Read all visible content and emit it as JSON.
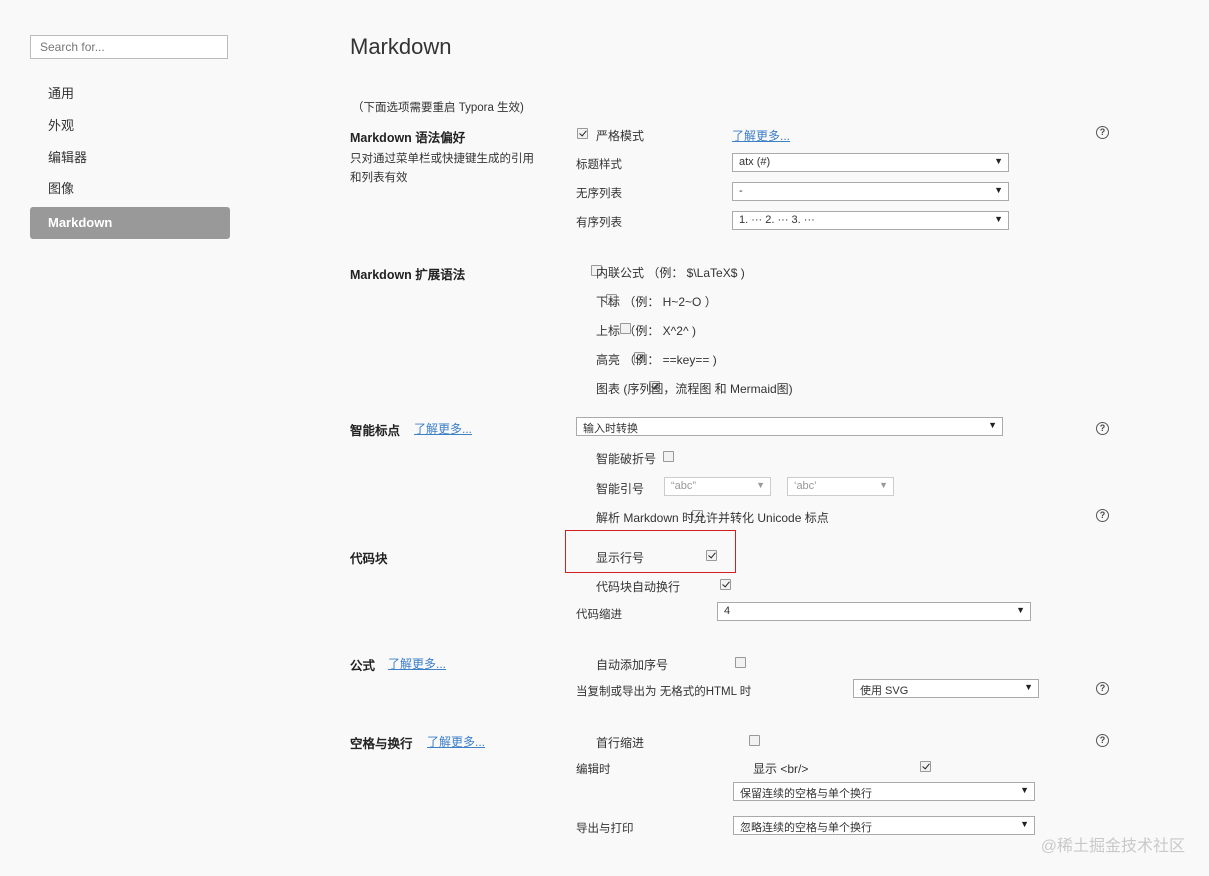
{
  "sidebar": {
    "search_placeholder": "Search for...",
    "items": [
      {
        "label": "通用"
      },
      {
        "label": "外观"
      },
      {
        "label": "编辑器"
      },
      {
        "label": "图像"
      },
      {
        "label": "Markdown",
        "active": true
      }
    ]
  },
  "page": {
    "title": "Markdown",
    "restart_note": "（下面选项需要重启 Typora 生效)"
  },
  "syntax_pref": {
    "label": "Markdown 语法偏好",
    "desc_line1": "只对通过菜单栏或快捷键生成的引用",
    "desc_line2": "和列表有效",
    "strict_label": "严格模式",
    "strict_checked": true,
    "learn_more": "了解更多...",
    "heading_style_label": "标题样式",
    "heading_style_value": "atx (#)",
    "ul_label": "无序列表",
    "ul_value": "-",
    "ol_label": "有序列表",
    "ol_value": "1. ··· 2. ··· 3. ···"
  },
  "ext_syntax": {
    "label": "Markdown 扩展语法",
    "options": [
      {
        "label": "内联公式 （例：  $\\LaTeX$ )",
        "checked": false
      },
      {
        "label": "下标 （例：  H~2~O ）",
        "checked": false
      },
      {
        "label": "上标 （例：  X^2^ )",
        "checked": false
      },
      {
        "label": "高亮 （例：  ==key== )",
        "checked": true
      },
      {
        "label": "图表      (序列图，流程图 和 Mermaid图)",
        "checked": true
      }
    ]
  },
  "smart_punct": {
    "label": "智能标点",
    "learn_more": "了解更多...",
    "mode_value": "输入时转换",
    "dash_label": "智能破折号",
    "dash_checked": false,
    "quote_label": "智能引号",
    "quote_checked": false,
    "quote_double_value": "“abc”",
    "quote_single_value": "‘abc’",
    "unicode_label": "解析 Markdown 时允许并转化 Unicode 标点",
    "unicode_checked": false
  },
  "code_block": {
    "label": "代码块",
    "line_numbers_label": "显示行号",
    "line_numbers_checked": true,
    "wrap_label": "代码块自动换行",
    "wrap_checked": true,
    "indent_label": "代码缩进",
    "indent_value": "4"
  },
  "math": {
    "label": "公式",
    "learn_more": "了解更多...",
    "auto_number_label": "自动添加序号",
    "auto_number_checked": false,
    "export_label": "当复制或导出为 无格式的HTML 时",
    "export_value": "使用 SVG"
  },
  "whitespace": {
    "label": "空格与换行",
    "learn_more": "了解更多...",
    "first_indent_label": "首行缩进",
    "first_indent_checked": false,
    "editing_label": "编辑时",
    "show_br_label": "显示 <br/>",
    "show_br_checked": true,
    "editing_value": "保留连续的空格与单个换行",
    "export_label": "导出与打印",
    "export_value": "忽略连续的空格与单个换行"
  },
  "help_icon_glyph": "?",
  "watermark": "@稀土掘金技术社区",
  "colors": {
    "accent_link": "#3d7fc9",
    "highlight_box": "#d21f1f",
    "active_nav": "#999999"
  }
}
